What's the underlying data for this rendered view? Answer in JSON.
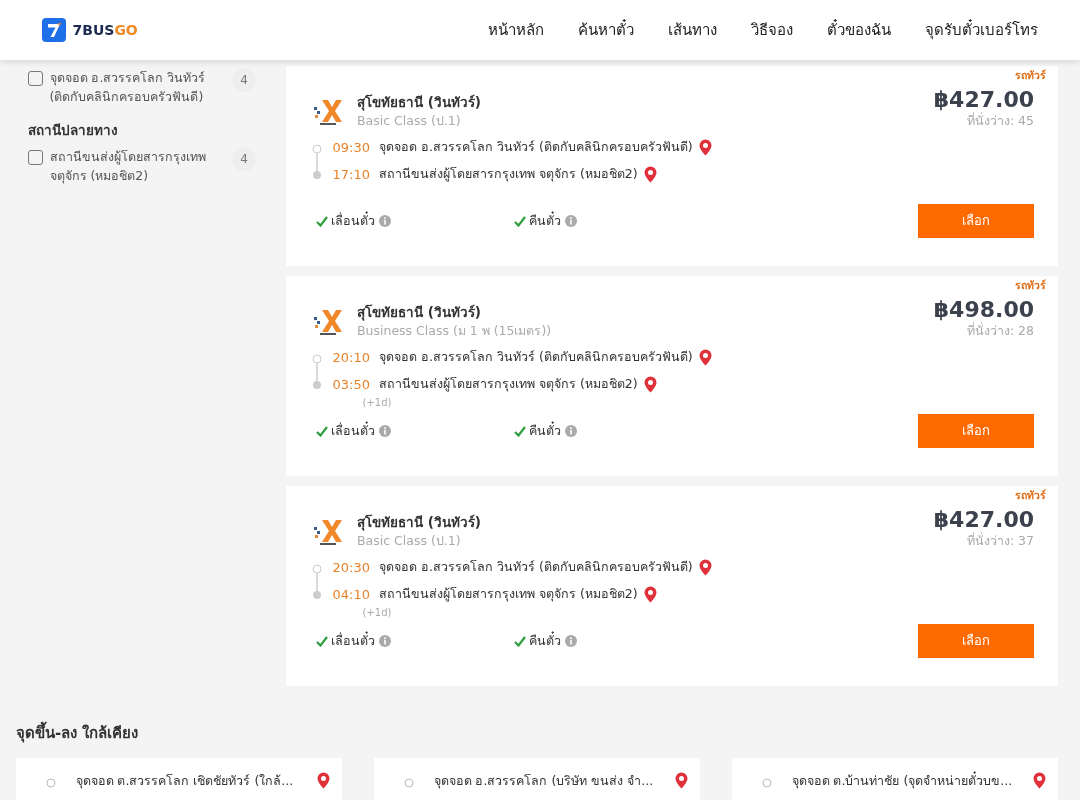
{
  "navbar": {
    "logo_primary": "7BUS",
    "logo_accent": "GO",
    "menu": [
      "หน้าหลัก",
      "ค้นหาตั๋ว",
      "เส้นทาง",
      "วิธีจอง",
      "ตั๋วของฉัน",
      "จุดรับตั๋วเบอร์โทร"
    ]
  },
  "sidebar": {
    "origin_items": [
      {
        "label": "จุดจอด อ.สวรรคโลก วินทัวร์ (ติดกับคลินิกครอบครัวฟันดี)",
        "count": "4",
        "checked": false
      }
    ],
    "destination": {
      "title": "สถานีปลายทาง",
      "items": [
        {
          "label": "สถานีขนส่งผู้โดยสารกรุงเทพ จตุจักร (หมอชิต2)",
          "count": "4",
          "checked": false
        }
      ]
    }
  },
  "trips": [
    {
      "tag": "รถทัวร์",
      "operator": "สุโขทัยธานี (วินทัวร์)",
      "class": "Basic Class (ป.1)",
      "price": "฿427.00",
      "seats": "ที่นั่งว่าง: 45",
      "departure": {
        "time": "09:30",
        "place": "จุดจอด อ.สวรรคโลก วินทัวร์ (ติดกับคลินิกครอบครัวฟันดี)"
      },
      "arrival": {
        "time": "17:10",
        "place": "สถานีขนส่งผู้โดยสารกรุงเทพ จตุจักร (หมอชิต2)"
      },
      "features": [
        {
          "label": "เลื่อนตั๋ว",
          "available": true
        },
        {
          "label": "คืนตั๋ว",
          "available": true
        }
      ],
      "button": "เลือก"
    },
    {
      "tag": "รถทัวร์",
      "operator": "สุโขทัยธานี (วินทัวร์)",
      "class": "Business Class (ม 1 พ (15เมตร))",
      "price": "฿498.00",
      "seats": "ที่นั่งว่าง: 28",
      "departure": {
        "time": "20:10",
        "place": "จุดจอด อ.สวรรคโลก วินทัวร์ (ติดกับคลินิกครอบครัวฟันดี)"
      },
      "arrival": {
        "time": "03:50",
        "place": "สถานีขนส่งผู้โดยสารกรุงเทพ จตุจักร (หมอชิต2)",
        "day_offset": "(+1d)"
      },
      "features": [
        {
          "label": "เลื่อนตั๋ว",
          "available": true
        },
        {
          "label": "คืนตั๋ว",
          "available": true
        }
      ],
      "button": "เลือก"
    },
    {
      "tag": "รถทัวร์",
      "operator": "สุโขทัยธานี (วินทัวร์)",
      "class": "Basic Class (ป.1)",
      "price": "฿427.00",
      "seats": "ที่นั่งว่าง: 37",
      "departure": {
        "time": "20:30",
        "place": "จุดจอด อ.สวรรคโลก วินทัวร์ (ติดกับคลินิกครอบครัวฟันดี)"
      },
      "arrival": {
        "time": "04:10",
        "place": "สถานีขนส่งผู้โดยสารกรุงเทพ จตุจักร (หมอชิต2)",
        "day_offset": "(+1d)"
      },
      "features": [
        {
          "label": "เลื่อนตั๋ว",
          "available": true
        },
        {
          "label": "คืนตั๋ว",
          "available": true
        }
      ],
      "button": "เลือก"
    }
  ],
  "nearby": {
    "title": "จุดขึ้น-ลง ใกล้เคียง",
    "stops": [
      {
        "label": "จุดจอด ต.สวรรคโลก เชิดชัยทัวร์ (ใกล้..."
      },
      {
        "label": "จุดจอด อ.สวรรคโลก (บริษัท ขนส่ง จำ..."
      },
      {
        "label": "จุดจอด ต.บ้านท่าชัย (จุดจำหน่ายตั๋วบข..."
      }
    ]
  }
}
